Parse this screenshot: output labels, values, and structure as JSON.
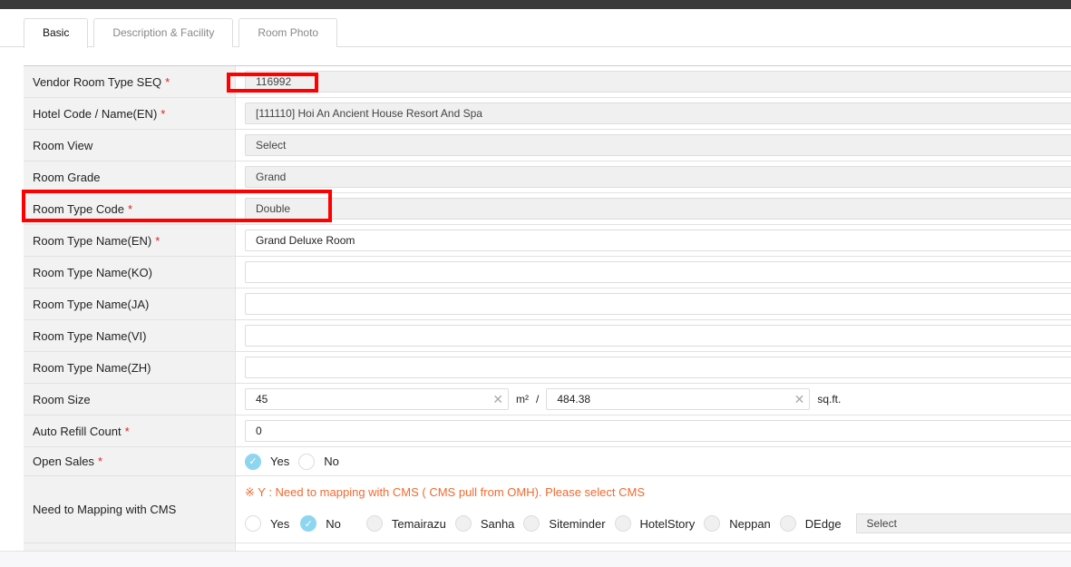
{
  "tabs": [
    "Basic",
    "Description & Facility",
    "Room Photo"
  ],
  "fields": {
    "vendor_seq": {
      "label": "Vendor Room Type SEQ",
      "value": "116992"
    },
    "hotel": {
      "label": "Hotel Code / Name(EN)",
      "value": "[111110] Hoi An Ancient House Resort And Spa"
    },
    "room_view": {
      "label": "Room View",
      "value": "Select"
    },
    "room_grade": {
      "label": "Room Grade",
      "value": "Grand"
    },
    "room_type_code": {
      "label": "Room Type Code",
      "value": "Double"
    },
    "name_en": {
      "label": "Room Type Name(EN)",
      "value": "Grand Deluxe Room"
    },
    "name_ko": {
      "label": "Room Type Name(KO)",
      "value": ""
    },
    "name_ja": {
      "label": "Room Type Name(JA)",
      "value": ""
    },
    "name_vi": {
      "label": "Room Type Name(VI)",
      "value": ""
    },
    "name_zh": {
      "label": "Room Type Name(ZH)",
      "value": ""
    },
    "room_size": {
      "label": "Room Size",
      "m2": "45",
      "m2_unit": "m²",
      "sep": "/",
      "sqft": "484.38",
      "sqft_unit": "sq.ft."
    },
    "auto_refill": {
      "label": "Auto Refill Count",
      "value": "0"
    },
    "open_sales": {
      "label": "Open Sales",
      "yes": "Yes",
      "no": "No",
      "selected": "Yes"
    },
    "cms": {
      "label": "Need to Mapping with CMS",
      "note": "※ Y : Need to mapping with CMS ( CMS pull from OMH). Please select CMS",
      "yes": "Yes",
      "no": "No",
      "selected": "No",
      "options": [
        "Temairazu",
        "Sanha",
        "Siteminder",
        "HotelStory",
        "Neppan",
        "DEdge"
      ],
      "select": "Select"
    }
  },
  "required_mark": "*",
  "colors": {
    "highlight": "#ff0000",
    "required": "#e0202a",
    "note": "#f26a2f",
    "radio_on": "#8ed6ef"
  }
}
